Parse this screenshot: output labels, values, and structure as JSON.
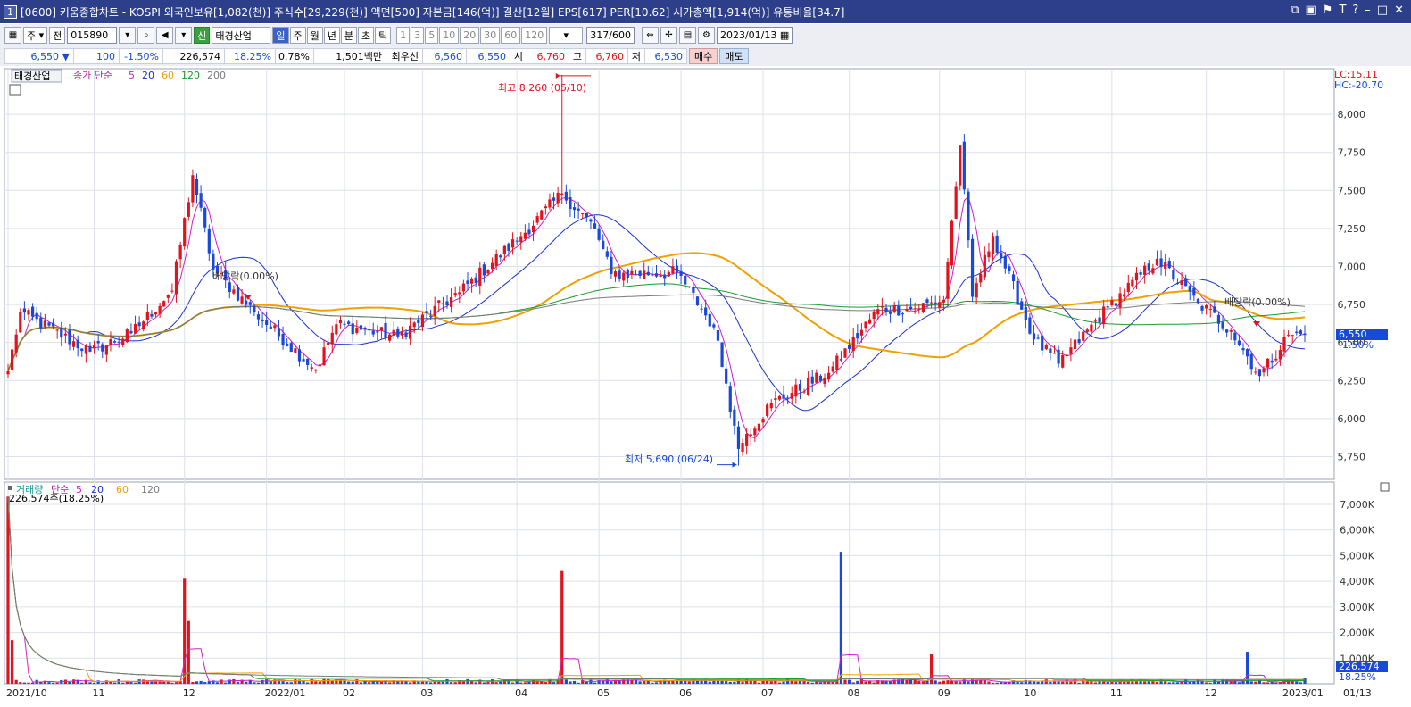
{
  "window": {
    "index": "1",
    "title": "[0600] 키움종합차트 - KOSPI 외국인보유[1,082(천)] 주식수[29,229(천)] 액면[500] 자본금[146(억)] 결산[12월] EPS[617] PER[10.62] 시가총액[1,914(억)] 유통비율[34.7]"
  },
  "toolbar": {
    "market": "주",
    "market2": "전",
    "code": "015890",
    "badge": "신",
    "name": "태경산업",
    "periods": [
      "일",
      "주",
      "월",
      "년",
      "분",
      "초",
      "틱"
    ],
    "selected_period": "일",
    "intervals": [
      "1",
      "3",
      "5",
      "10",
      "20",
      "30",
      "60",
      "120"
    ],
    "count": "317",
    "count_total": "/600",
    "date": "2023/01/13"
  },
  "price_bar": {
    "price": "6,550",
    "change_arrow": "▼",
    "change": "100",
    "change_pct": "-1.50%",
    "volume": "226,574",
    "vol_ratio": "18.25%",
    "turnover": "0.78%",
    "amount": "1,501백만",
    "priority_label": "최우선",
    "bid1": "6,560",
    "ask1": "6,550",
    "open_label": "시",
    "open": "6,760",
    "high_label": "고",
    "high": "6,760",
    "low_label": "저",
    "low": "6,530",
    "buy_btn": "매수",
    "sell_btn": "매도"
  },
  "colors": {
    "up": "#e0141e",
    "down": "#1a49d8",
    "ma5": "#d020c8",
    "ma20": "#1a32d0",
    "ma60": "#f0a000",
    "ma120": "#1a9a30",
    "ma200": "#7a7a7a"
  },
  "price_panel": {
    "stock_label": "태경산업",
    "legend": [
      "종가 단순",
      "5",
      "20",
      "60",
      "120",
      "200"
    ],
    "lc": "LC:15.11",
    "hc": "HC:-20.70",
    "current_price": "6,550",
    "current_pct": "-1.50%",
    "high_annotation": "최고 8,260 (05/10)",
    "low_annotation": "최저 5,690 (06/24)",
    "div1": "배당락(0.00%)",
    "div2": "배당락(0.00%)"
  },
  "volume_panel": {
    "legend": [
      "거래량",
      "단순",
      "5",
      "20",
      "60",
      "120"
    ],
    "current_label": "226,574주(18.25%)",
    "current_value": "226,574",
    "current_pct": "18.25%"
  },
  "x_axis": {
    "labels": [
      "2021/10",
      "11",
      "12",
      "2022/01",
      "02",
      "03",
      "04",
      "05",
      "06",
      "07",
      "08",
      "09",
      "10",
      "11",
      "12",
      "2023/01"
    ],
    "end_label": "01/13"
  },
  "chart_data": [
    {
      "type": "candlestick",
      "y_ticks": [
        5750,
        6000,
        6250,
        6500,
        6750,
        7000,
        7250,
        7500,
        7750,
        8000
      ],
      "y_tick_labels": [
        "5,750",
        "6,000",
        "6,250",
        "6,500",
        "6,750",
        "7,000",
        "7,250",
        "7,500",
        "7,750",
        "8,000"
      ],
      "ylim": [
        5600,
        8300
      ],
      "high": 8260,
      "low": 5690,
      "last_close": 6550,
      "close_anchors": [
        [
          0,
          6310
        ],
        [
          3,
          6700
        ],
        [
          20,
          6440
        ],
        [
          30,
          6560
        ],
        [
          40,
          6840
        ],
        [
          45,
          7600
        ],
        [
          50,
          6980
        ],
        [
          60,
          6700
        ],
        [
          75,
          6320
        ],
        [
          80,
          6620
        ],
        [
          95,
          6540
        ],
        [
          110,
          6830
        ],
        [
          125,
          7200
        ],
        [
          135,
          7480
        ],
        [
          143,
          7250
        ],
        [
          147,
          6950
        ],
        [
          163,
          6960
        ],
        [
          172,
          6600
        ],
        [
          175,
          6230
        ],
        [
          178,
          5800
        ],
        [
          180,
          5900
        ],
        [
          186,
          6100
        ],
        [
          200,
          6300
        ],
        [
          212,
          6720
        ],
        [
          220,
          6720
        ],
        [
          228,
          6780
        ],
        [
          232,
          7800
        ],
        [
          235,
          6800
        ],
        [
          240,
          7200
        ],
        [
          250,
          6520
        ],
        [
          256,
          6360
        ],
        [
          268,
          6730
        ],
        [
          280,
          7050
        ],
        [
          290,
          6760
        ],
        [
          298,
          6580
        ],
        [
          305,
          6280
        ],
        [
          312,
          6550
        ],
        [
          316,
          6550
        ]
      ],
      "ma_series": [
        "5",
        "20",
        "60",
        "120",
        "200"
      ]
    },
    {
      "type": "bar",
      "name": "volume",
      "y_ticks": [
        1000,
        2000,
        3000,
        4000,
        5000,
        6000,
        7000
      ],
      "y_tick_labels": [
        "1,000K",
        "2,000K",
        "3,000K",
        "4,000K",
        "5,000K",
        "6,000K",
        "7,000K"
      ],
      "ylim": [
        0,
        7800
      ],
      "base_volume_k": 100,
      "spikes_k": [
        [
          0,
          7300
        ],
        [
          1,
          1700
        ],
        [
          43,
          4100
        ],
        [
          44,
          2450
        ],
        [
          135,
          4400
        ],
        [
          203,
          5150
        ],
        [
          225,
          1150
        ],
        [
          302,
          1250
        ],
        [
          316,
          227
        ]
      ]
    }
  ]
}
